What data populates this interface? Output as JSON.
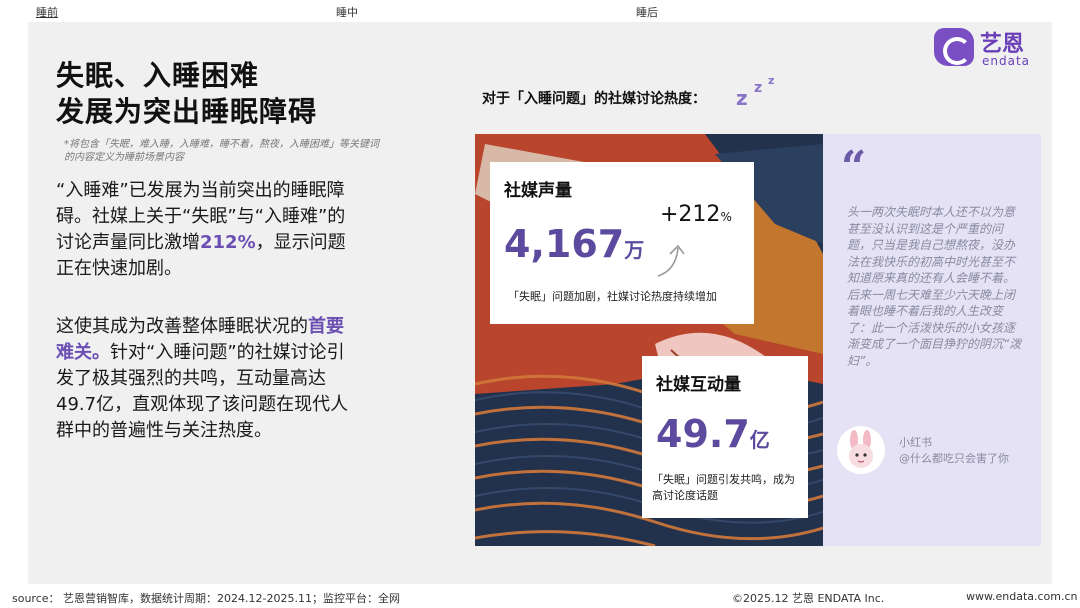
{
  "nav": {
    "tabs": [
      "睡前",
      "睡中",
      "睡后"
    ]
  },
  "headline": {
    "line1": "失眠、入睡困难",
    "line2": "发展为突出睡眠障碍"
  },
  "note": "*将包含「失眠，难入睡，入睡难，睡不着，熬夜，入睡困难」等关键词的内容定义为睡前场景内容",
  "para1": {
    "before": "“入睡难”已发展为当前突出的睡眠障碍。社媒上关于“失眠”与“入睡难”的讨论声量同比激增",
    "highlight": "212%",
    "after": "，显示问题正在快速加剧。"
  },
  "para2": {
    "before": "这使其成为改善整体睡眠状况的",
    "highlight": "首要难关。",
    "after": "针对“入睡问题”的社媒讨论引发了极其强烈的共鸣，互动量高达49.7亿，直观体现了该问题在现代人群中的普遍性与关注热度。"
  },
  "section": {
    "title": "对于「入睡问题」的社媒讨论热度：",
    "zzz": [
      "z",
      "z",
      "z"
    ]
  },
  "logo": {
    "cn": "艺恩",
    "en": "endata",
    "color": "#6a3fb8"
  },
  "card_volume": {
    "title": "社媒声量",
    "value": "4,167",
    "unit": "万",
    "growth": "+212",
    "growth_unit": "%",
    "note": "「失眠」问题加剧，社媒讨论热度持续增加"
  },
  "card_interaction": {
    "title": "社媒互动量",
    "value": "49.7",
    "unit": "亿",
    "note": "「失眠」问题引发共鸣，成为高讨论度话题"
  },
  "quote": {
    "mark": "“",
    "text": "头一两次失眠时本人还不以为意甚至没认识到这是个严重的问题，只当是我自己想熬夜，没办法在我快乐的初高中时光甚至不知道原来真的还有人会睡不着。后来一周七天难至少六天晚上闭着眼也睡不着后我的人生改变了：此一个活泼快乐的小女孩逐渐变成了一个面目狰狞的阴沉“泼妇”。",
    "platform": "小红书",
    "user": "@什么都吃只会害了你"
  },
  "footer": {
    "source": "source： 艺恩营销智库，数据统计周期：2024.12-2025.11；监控平台：全网",
    "copyright": "©2025.12 艺恩 ENDATA Inc.",
    "website": "www.endata.com.cn"
  },
  "colors": {
    "accent": "#6b4fb3",
    "panel": "#f0f0f0",
    "quote_bg": "#e4e2f4",
    "number": "#5b4a9e"
  }
}
